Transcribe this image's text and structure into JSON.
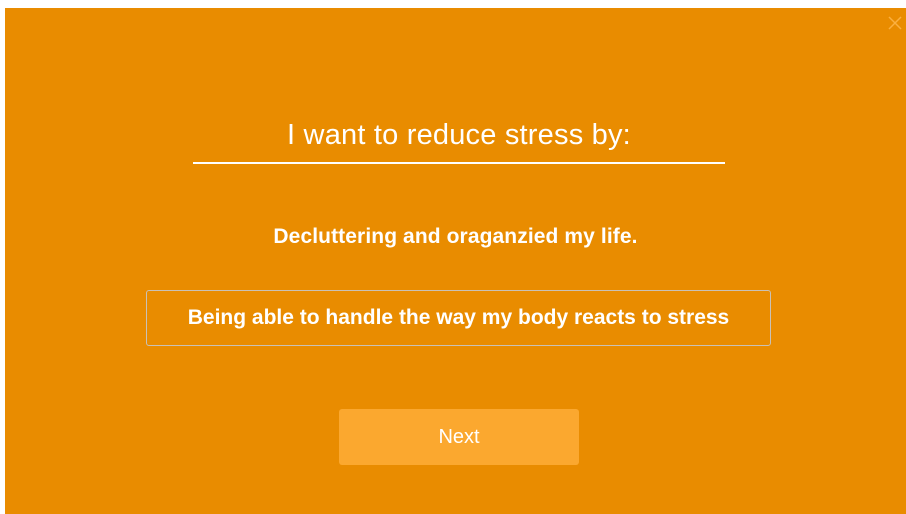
{
  "dialog": {
    "title": "I want to reduce stress by:",
    "options": [
      {
        "label": "Decluttering and oraganzied my life."
      },
      {
        "label": "Being able to handle the way my body reacts to stress"
      }
    ],
    "next_label": "Next",
    "close_icon": "close-icon"
  },
  "colors": {
    "background": "#e98c00",
    "button": "#fba82f",
    "text": "#ffffff",
    "close_icon": "#fbb040"
  }
}
